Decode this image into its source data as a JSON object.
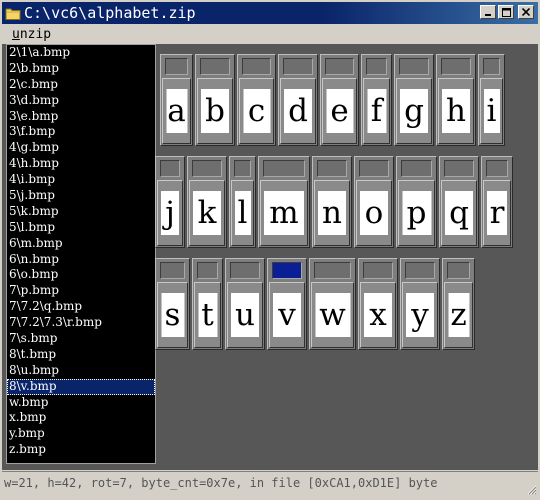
{
  "window": {
    "title": "C:\\vc6\\alphabet.zip",
    "minimize_label": "_",
    "maximize_label": "□",
    "close_label": "×"
  },
  "menu": {
    "items": [
      {
        "label_underlined": "u",
        "label_rest": "nzip"
      }
    ]
  },
  "file_list": {
    "items": [
      "2\\1\\a.bmp",
      "2\\b.bmp",
      "2\\c.bmp",
      "3\\d.bmp",
      "3\\e.bmp",
      "3\\f.bmp",
      "4\\g.bmp",
      "4\\h.bmp",
      "4\\i.bmp",
      "5\\j.bmp",
      "5\\k.bmp",
      "5\\l.bmp",
      "6\\m.bmp",
      "6\\n.bmp",
      "6\\o.bmp",
      "7\\p.bmp",
      "7\\7.2\\q.bmp",
      "7\\7.2\\7.3\\r.bmp",
      "7\\s.bmp",
      "8\\t.bmp",
      "8\\u.bmp",
      "8\\v.bmp",
      "w.bmp",
      "x.bmp",
      "y.bmp",
      "z.bmp"
    ],
    "selected_index": 21
  },
  "tiles": {
    "letters": [
      "a",
      "b",
      "c",
      "d",
      "e",
      "f",
      "g",
      "h",
      "i",
      "j",
      "k",
      "l",
      "m",
      "n",
      "o",
      "p",
      "q",
      "r",
      "s",
      "t",
      "u",
      "v",
      "w",
      "x",
      "y",
      "z"
    ],
    "active_letter": "v"
  },
  "status": {
    "text": "w=21, h=42, rot=7, byte_cnt=0x7e, in file [0xCA1,0xD1E] byte"
  },
  "colors": {
    "title_bar": "#0a246a",
    "workspace": "#575757",
    "active_tile_header": "#0a1e96",
    "selection": "#0a246a"
  }
}
